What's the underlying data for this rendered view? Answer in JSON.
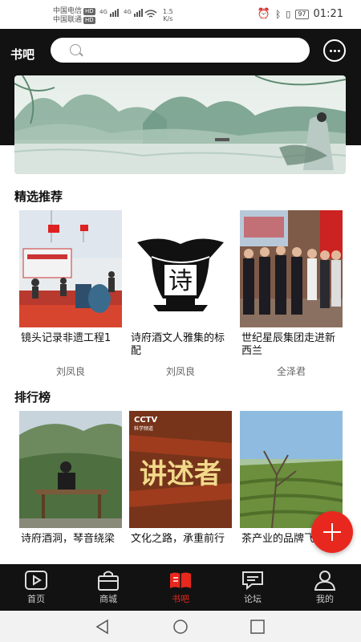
{
  "status_bar": {
    "carrier_1": "中国电信",
    "carrier_2": "中国联通",
    "hd_badge": "HD",
    "network_1": "4G",
    "network_2": "4G",
    "speed_value": "1.5",
    "speed_unit": "K/s",
    "battery": "97",
    "time": "01:21"
  },
  "header": {
    "title": "书吧",
    "search_placeholder": ""
  },
  "featured": {
    "title": "精选推荐",
    "cards": [
      {
        "title": "镜头记录非遗工程1",
        "author": "刘凤良"
      },
      {
        "title": "诗府酒文人雅集的标配",
        "author": "刘凤良"
      },
      {
        "title": "世纪星辰集团走进新西兰",
        "author": "全泽君"
      }
    ]
  },
  "ranking": {
    "title": "排行榜",
    "cards": [
      {
        "title": "诗府酒洞，琴音绕梁"
      },
      {
        "title": "文化之路，承重前行"
      },
      {
        "title": "茶产业的品牌飞"
      }
    ]
  },
  "image_text": {
    "cctv_logo": "CCTV",
    "cctv_sub": "科学频道",
    "show_name": "讲述者",
    "vessel_char": "诗"
  },
  "tabs": [
    {
      "label": "首页",
      "icon": "play-square-icon"
    },
    {
      "label": "商城",
      "icon": "shopping-bag-icon"
    },
    {
      "label": "书吧",
      "icon": "book-icon",
      "active": true
    },
    {
      "label": "论坛",
      "icon": "chat-bubble-icon"
    },
    {
      "label": "我的",
      "icon": "person-icon"
    }
  ],
  "colors": {
    "accent": "#e8281e",
    "header_bg": "#121212",
    "tabbar_bg": "#121212"
  }
}
